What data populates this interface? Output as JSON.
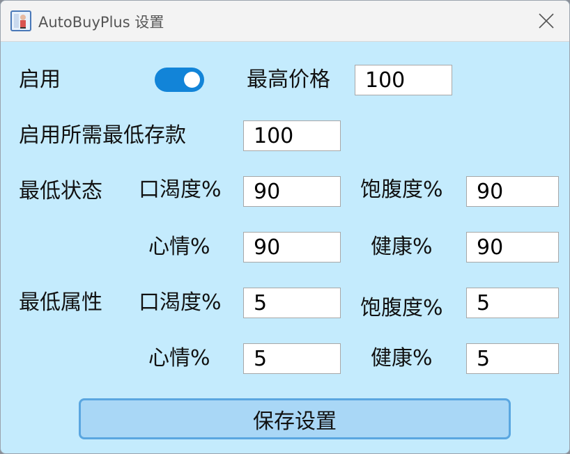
{
  "window": {
    "title": "AutoBuyPlus 设置"
  },
  "icons": {
    "app": "app-icon",
    "close": "close-icon"
  },
  "colors": {
    "background": "#c4ebfd",
    "toggle_on": "#1284d8",
    "button": "#a9d7f6",
    "button_border": "#5aa6e0"
  },
  "settings": {
    "enable_label": "启用",
    "enable_on": true,
    "max_price_label": "最高价格",
    "max_price_value": "100",
    "min_deposit_label": "启用所需最低存款",
    "min_deposit_value": "100"
  },
  "min_status": {
    "label": "最低状态",
    "thirst_label": "口渴度%",
    "thirst_value": "90",
    "satiety_label": "饱腹度%",
    "satiety_value": "90",
    "mood_label": "心情%",
    "mood_value": "90",
    "health_label": "健康%",
    "health_value": "90"
  },
  "min_attributes": {
    "label": "最低属性",
    "thirst_label": "口渴度%",
    "thirst_value": "5",
    "satiety_label": "饱腹度%",
    "satiety_value": "5",
    "mood_label": "心情%",
    "mood_value": "5",
    "health_label": "健康%",
    "health_value": "5"
  },
  "actions": {
    "save_label": "保存设置"
  }
}
